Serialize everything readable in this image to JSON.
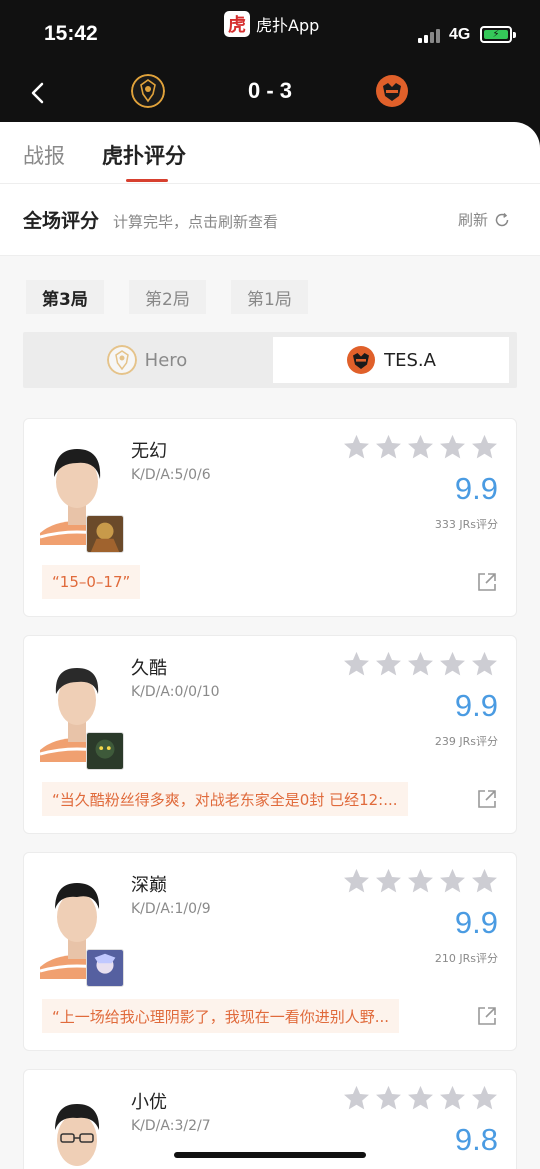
{
  "status": {
    "time": "15:42",
    "app_name": "虎扑App",
    "app_logo_char": "虎",
    "network": "4G"
  },
  "match": {
    "score": "0 - 3"
  },
  "tabs": [
    {
      "label": "战报"
    },
    {
      "label": "虎扑评分"
    }
  ],
  "rating": {
    "title": "全场评分",
    "subtitle": "计算完毕，点击刷新查看",
    "refresh_label": "刷新"
  },
  "games": [
    {
      "label": "第3局"
    },
    {
      "label": "第2局"
    },
    {
      "label": "第1局"
    }
  ],
  "teams": [
    {
      "name": "Hero"
    },
    {
      "name": "TES.A"
    }
  ],
  "colors": {
    "accent": "#d7402f",
    "score_blue": "#4a9be2",
    "comment_text": "#e06a3b",
    "comment_bg": "#fdf3ec"
  },
  "players": [
    {
      "name": "无幻",
      "kda": "K/D/A:5/0/6",
      "score": "9.9",
      "jr_count": "333 JRs评分",
      "comment": "“15–0–17”"
    },
    {
      "name": "久酷",
      "kda": "K/D/A:0/0/10",
      "score": "9.9",
      "jr_count": "239 JRs评分",
      "comment": "“当久酷粉丝得多爽，对战老东家全是0封 已经12:..."
    },
    {
      "name": "深巅",
      "kda": "K/D/A:1/0/9",
      "score": "9.9",
      "jr_count": "210 JRs评分",
      "comment": "“上一场给我心理阴影了，我现在一看你进别人野..."
    },
    {
      "name": "小优",
      "kda": "K/D/A:3/2/7",
      "score": "9.8",
      "jr_count": "",
      "comment": ""
    }
  ],
  "icons": {
    "back": "chevron-left-icon",
    "refresh": "refresh-icon",
    "share": "share-icon",
    "star": "star-icon"
  }
}
